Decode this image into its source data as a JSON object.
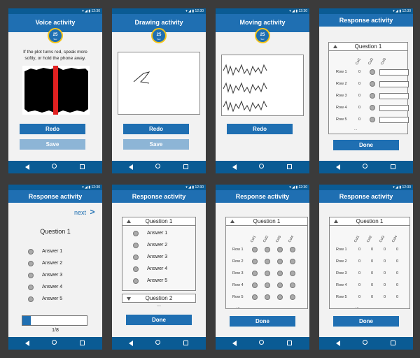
{
  "status_bar": {
    "time": "12:30",
    "icons": "▾ ◢ ▮"
  },
  "timer": {
    "value": "25",
    "unit": "Sec"
  },
  "nav": {
    "back": "back-icon",
    "home": "home-icon",
    "recent": "recent-apps-icon"
  },
  "colors": {
    "primary": "#1f6fb2",
    "dark": "#0a5b94",
    "accent": "#f4c419",
    "disabled": "#8db5d6",
    "danger": "#e02020"
  },
  "screen1": {
    "title": "Voice activity",
    "instruction_line1": "If the plot turns red, speak more",
    "instruction_line2": "softly, or hold the phone away.",
    "redo": "Redo",
    "save": "Save"
  },
  "screen2": {
    "title": "Drawing activity",
    "redo": "Redo",
    "save": "Save"
  },
  "screen3": {
    "title": "Moving activity",
    "redo": "Redo"
  },
  "screen4": {
    "title": "Response activity",
    "question": "Question 1",
    "cols": [
      "Col1",
      "Col2",
      "Col3"
    ],
    "rows": [
      "Row 1",
      "Row 2",
      "Row 3",
      "Row 4",
      "Row 5"
    ],
    "zero": "0",
    "ellipsis": "...",
    "done": "Done"
  },
  "screen5": {
    "title": "Response activity",
    "next": "next",
    "next_icon": ">",
    "question": "Question 1",
    "answers": [
      "Answer 1",
      "Answer 2",
      "Answer 3",
      "Answer 4",
      "Answer 5"
    ],
    "progress_text": "1/8",
    "progress_fraction": 0.125
  },
  "screen6": {
    "title": "Response activity",
    "question1": "Question 1",
    "question2": "Question 2",
    "answers": [
      "Answer 1",
      "Answer 2",
      "Answer 3",
      "Answer 4",
      "Answer 5"
    ],
    "ellipsis": "...",
    "done": "Done"
  },
  "screen7": {
    "title": "Response activity",
    "question": "Question 1",
    "cols": [
      "Col1",
      "Col2",
      "Col3",
      "Col4"
    ],
    "rows": [
      "Row 1",
      "Row 2",
      "Row 3",
      "Row 4",
      "Row 5"
    ],
    "ellipsis": "...",
    "done": "Done"
  },
  "screen8": {
    "title": "Response activity",
    "question": "Question 1",
    "cols": [
      "Col1",
      "Col2",
      "Col3",
      "Col4"
    ],
    "rows": [
      "Row 1",
      "Row 2",
      "Row 3",
      "Row 4",
      "Row 5"
    ],
    "zero": "0",
    "ellipsis": "...",
    "done": "Done"
  }
}
